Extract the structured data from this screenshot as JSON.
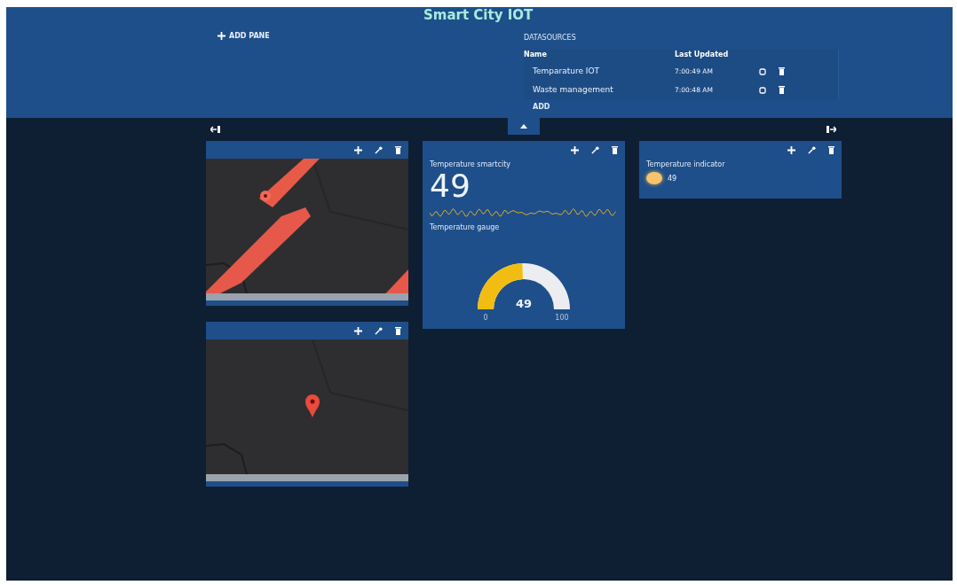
{
  "title": "Smart City IOT",
  "add_pane": "ADD PANE",
  "datasources": {
    "heading": "DATASOURCES",
    "columns": [
      "Name",
      "Last Updated"
    ],
    "rows": [
      {
        "name": "Temparature IOT",
        "last_updated": "7:00:49 AM"
      },
      {
        "name": "Waste management",
        "last_updated": "7:00:48 AM"
      }
    ],
    "add": "ADD"
  },
  "columns": [
    {
      "panes": [
        {
          "widgets": [
            {
              "kind": "picture"
            }
          ]
        },
        {
          "widgets": [
            {
              "kind": "picture"
            }
          ]
        }
      ]
    },
    {
      "panes": [
        {
          "widgets": [
            {
              "kind": "text",
              "title": "Temperature smartcity",
              "value": "49"
            },
            {
              "kind": "gauge",
              "title": "Temperature gauge",
              "value": "49",
              "min": "0",
              "max": "100"
            }
          ]
        }
      ]
    },
    {
      "panes": [
        {
          "widgets": [
            {
              "kind": "indicator",
              "title": "Temperature indicator",
              "value": "49",
              "on": true
            }
          ]
        }
      ]
    }
  ]
}
